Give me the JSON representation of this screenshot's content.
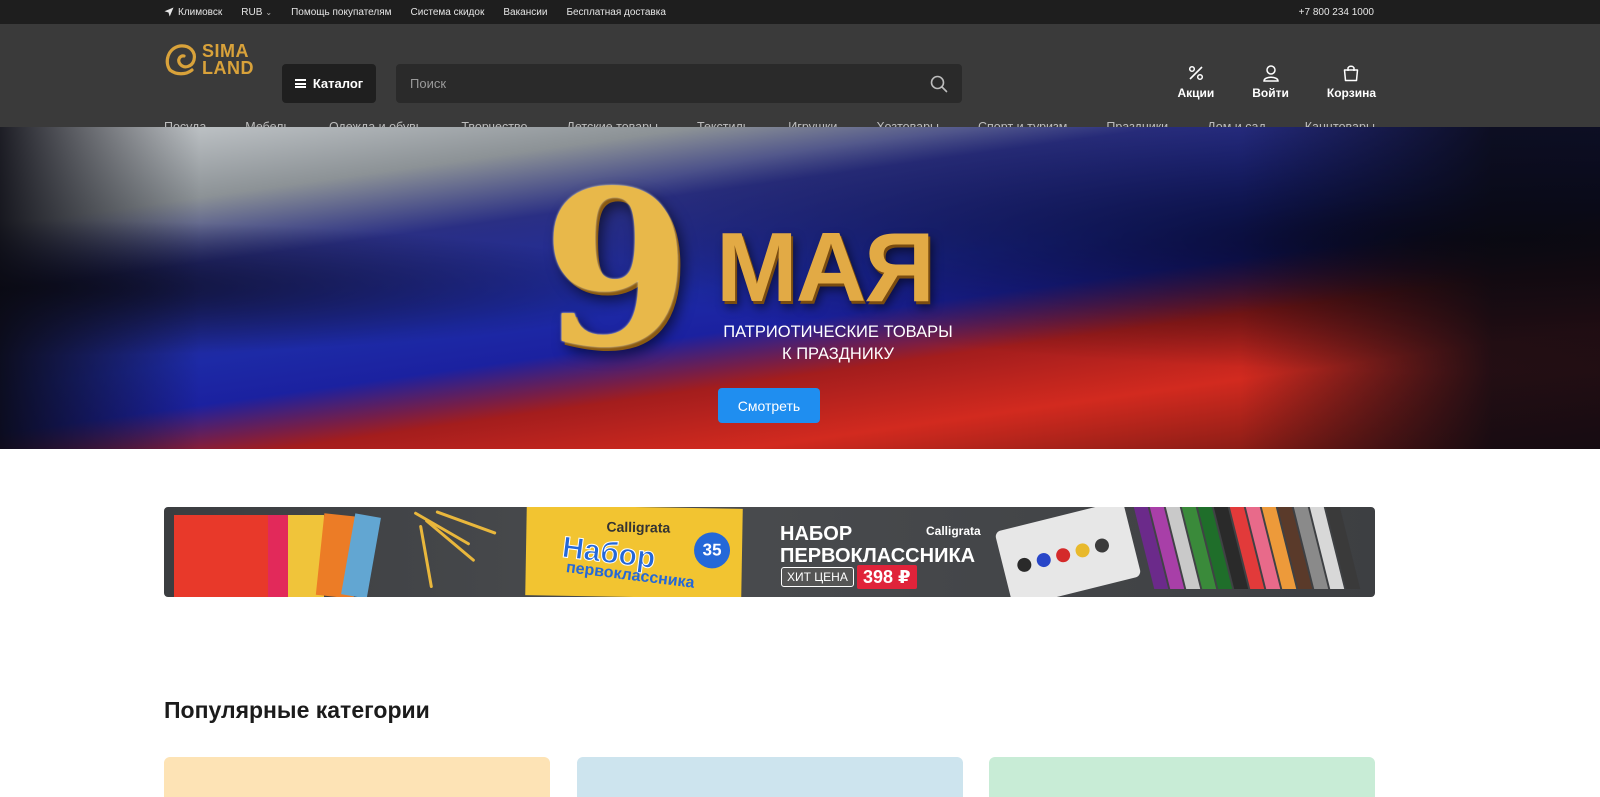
{
  "topbar": {
    "location": "Климовск",
    "currency": "RUB",
    "links": [
      "Помощь покупателям",
      "Система скидок",
      "Вакансии",
      "Бесплатная доставка"
    ],
    "phone": "+7 800 234 1000"
  },
  "header": {
    "logo_line1": "SIMA",
    "logo_line2": "LAND",
    "catalog_label": "Каталог",
    "search_placeholder": "Поиск",
    "actions": [
      {
        "label": "Акции",
        "icon": "percent-icon"
      },
      {
        "label": "Войти",
        "icon": "user-icon"
      },
      {
        "label": "Корзина",
        "icon": "bag-icon"
      }
    ],
    "categories": [
      "Посуда",
      "Мебель",
      "Одежда и обувь",
      "Творчество",
      "Детские товары",
      "Текстиль",
      "Игрушки",
      "Хозтовары",
      "Спорт и туризм",
      "Праздники",
      "Дом и сад",
      "Канцтовары"
    ]
  },
  "hero": {
    "number": "9",
    "word": "МАЯ",
    "subtitle_line1": "ПАТРИОТИЧЕСКИЕ ТОВАРЫ",
    "subtitle_line2": "К ПРАЗДНИКУ",
    "button_label": "Смотреть"
  },
  "promo": {
    "box_brand": "Calligrata",
    "box_title": "Набор",
    "box_subtitle": "первоклассника",
    "box_count": "35",
    "title_line1": "НАБОР",
    "title_line2": "ПЕРВОКЛАССНИКА",
    "brand": "Calligrata",
    "hit_label": "ХИТ ЦЕНА",
    "price": "398 ₽"
  },
  "popular": {
    "title": "Популярные категории",
    "card_colors": [
      "#fde3b5",
      "#cde4ee",
      "#c8ecd6"
    ]
  },
  "colors": {
    "accent_blue": "#1f8ef0",
    "brand_gold": "#d9a23a",
    "price_red": "#e0233a"
  }
}
